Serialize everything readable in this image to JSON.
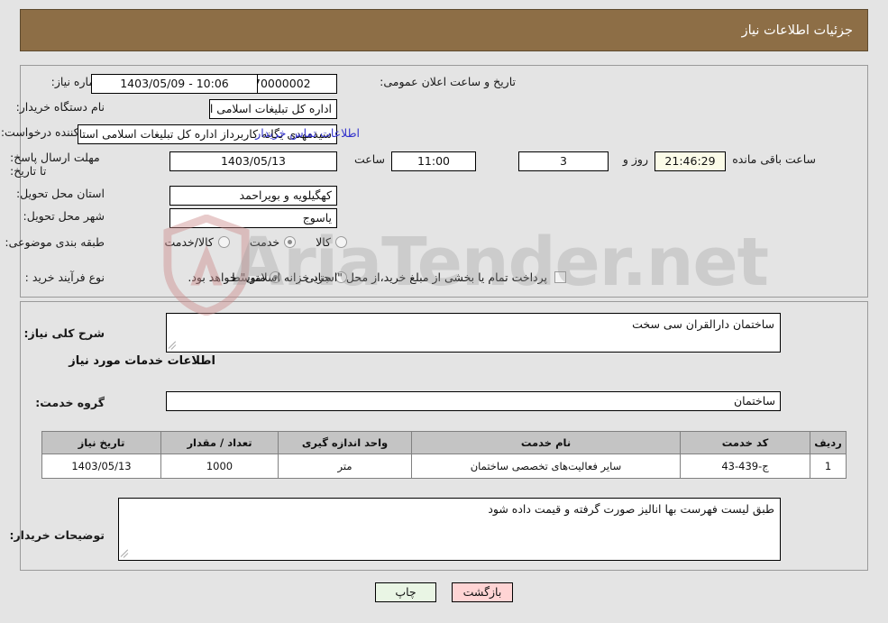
{
  "header": {
    "title": "جزئیات اطلاعات نیاز"
  },
  "watermark": {
    "text": "AriaTender.net"
  },
  "form": {
    "need_number_label": "شماره نیاز:",
    "need_number_value": "1103005470000002",
    "announce_datetime_label": "تاریخ و ساعت اعلان عمومی:",
    "announce_datetime_value": "10:06 - 1403/05/09",
    "buyer_org_label": "نام دستگاه خریدار:",
    "buyer_org_value": "اداره کل تبلیغات اسلامی استان کهگیلویه و بویراحمد",
    "requester_label": "ایجاد کننده درخواست:",
    "requester_value": "سیدمهدی یگانه کاربرداز اداره کل تبلیغات اسلامی استان کهگیلویه و بویراحمد",
    "contact_link": "اطلاعات تماس خریدار",
    "deadline_label": "مهلت ارسال پاسخ: تا تاریخ:",
    "deadline_date": "1403/05/13",
    "deadline_time_label": "ساعت",
    "deadline_time": "11:00",
    "remaining_days": "3",
    "remaining_days_label": "روز و",
    "remaining_clock": "21:46:29",
    "remaining_hours_label": "ساعت باقی مانده",
    "province_label": "استان محل تحویل:",
    "province_value": "کهگیلویه و بویراحمد",
    "city_label": "شهر محل تحویل:",
    "city_value": "یاسوج",
    "category_label": "طبقه بندی موضوعی:",
    "category_options": [
      {
        "label": "کالا",
        "selected": false
      },
      {
        "label": "خدمت",
        "selected": true
      },
      {
        "label": "کالا/خدمت",
        "selected": false
      }
    ],
    "process_type_label": "نوع فرآیند خرید :",
    "process_type_options": [
      {
        "label": "جزیی",
        "selected": false
      },
      {
        "label": "متوسط",
        "selected": true
      }
    ],
    "treasury_checkbox_checked": false,
    "treasury_note": "پرداخت تمام یا بخشی از مبلغ خرید،از محل \"اسناد خزانه اسلامی\" خواهد بود."
  },
  "details": {
    "general_desc_label": "شرح کلی نیاز:",
    "general_desc_value": "ساختمان دارالقران سی سخت",
    "services_section_title": "اطلاعات خدمات مورد نیاز",
    "service_group_label": "گروه خدمت:",
    "service_group_value": "ساختمان",
    "buyer_notes_label": "توضیحات خریدار:",
    "buyer_notes_value": "طبق لیست فهرست بها انالیز صورت گرفته و قیمت داده شود"
  },
  "items_table": {
    "columns": [
      "ردیف",
      "کد خدمت",
      "نام خدمت",
      "واحد اندازه گیری",
      "تعداد / مقدار",
      "تاریخ نیاز"
    ],
    "rows": [
      {
        "index": "1",
        "code": "ج-439-43",
        "name": "سایر فعالیت‌های تخصصی ساختمان",
        "unit": "متر",
        "quantity": "1000",
        "need_date": "1403/05/13"
      }
    ]
  },
  "footer": {
    "print_label": "چاپ",
    "back_label": "بازگشت"
  },
  "colors": {
    "header_bg": "#8d6e46",
    "page_bg": "#e4e4e4",
    "back_btn_bg": "#ffd4d4",
    "print_btn_bg": "#e9f5e4",
    "link": "#3333cc",
    "table_head_bg": "#c4c4c4",
    "countdown_bg": "#fbfbe8"
  }
}
